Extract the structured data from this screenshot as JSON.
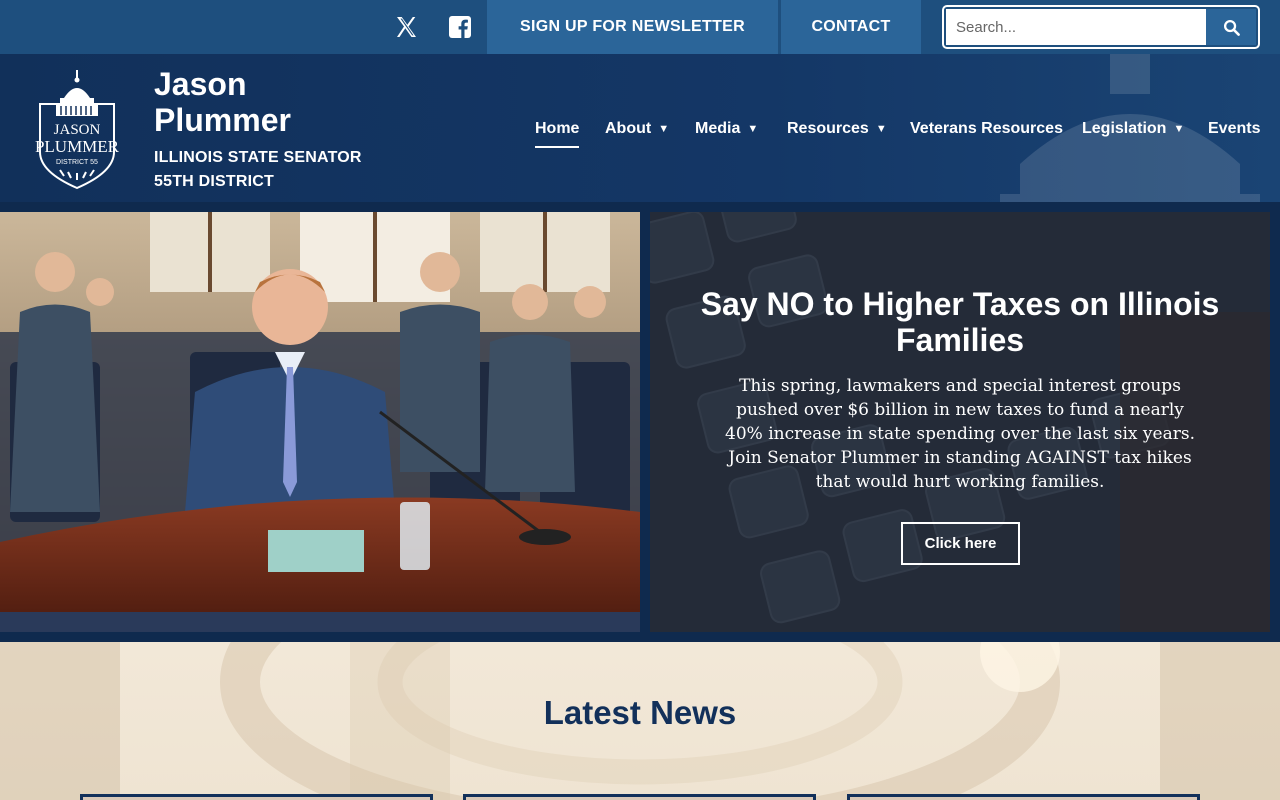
{
  "topbar": {
    "social": [
      {
        "name": "x-icon"
      },
      {
        "name": "facebook-icon"
      }
    ],
    "newsletter_label": "SIGN UP FOR NEWSLETTER",
    "contact_label": "CONTACT",
    "search": {
      "placeholder": "Search...",
      "value": ""
    }
  },
  "header": {
    "logo_lines": [
      "JASON",
      "PLUMMER",
      "DISTRICT 55"
    ],
    "site_name": "Jason Plummer",
    "tagline_line1": "ILLINOIS STATE SENATOR",
    "tagline_line2": "55TH DISTRICT"
  },
  "nav": {
    "items": [
      {
        "label": "Home",
        "active": true,
        "dropdown": false
      },
      {
        "label": "About",
        "active": false,
        "dropdown": true
      },
      {
        "label": "Media",
        "active": false,
        "dropdown": true
      },
      {
        "label": "Resources",
        "active": false,
        "dropdown": true
      },
      {
        "label": "Veterans Resources",
        "active": false,
        "dropdown": false
      },
      {
        "label": "Legislation",
        "active": false,
        "dropdown": true
      },
      {
        "label": "Events",
        "active": false,
        "dropdown": false
      }
    ]
  },
  "hero": {
    "title": "Say NO to Higher Taxes on Illinois Families",
    "body": "This spring, lawmakers and special interest groups pushed over $6 billion in new taxes to fund a nearly 40% increase in state spending over the last six years. Join Senator Plummer in standing AGAINST tax hikes that would hurt working families.",
    "button_label": "Click here"
  },
  "news": {
    "title": "Latest News"
  },
  "colors": {
    "topbar": "#1e4f7e",
    "topbar_button": "#2b6599",
    "header": "#12305a",
    "news_title": "#12305a"
  }
}
